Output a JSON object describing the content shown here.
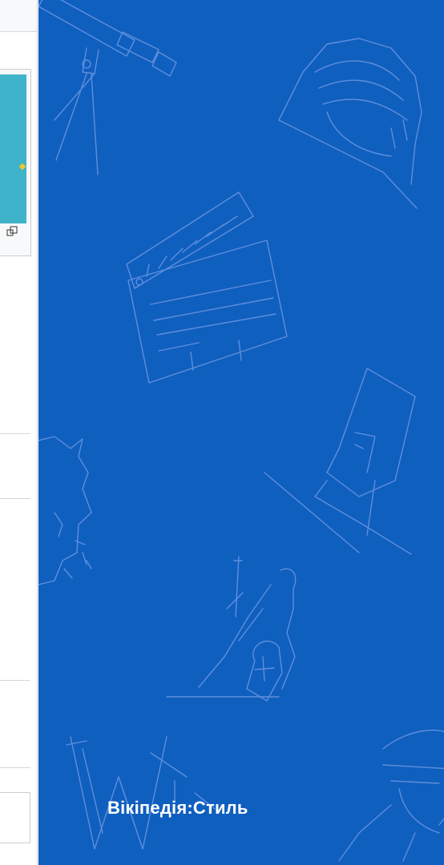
{
  "panel": {
    "caption": "Вікіпедія:Стиль",
    "background": "#0f5fbf"
  },
  "thumbnail": {
    "icon": "magnify-icon"
  }
}
